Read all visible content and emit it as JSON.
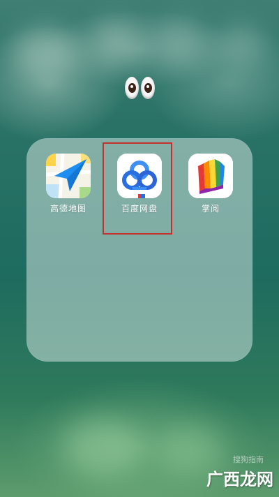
{
  "folder": {
    "apps": [
      {
        "label": "高德地图",
        "icon": "amap-icon",
        "highlighted": false
      },
      {
        "label": "百度网盘",
        "icon": "baidu-netdisk-icon",
        "highlighted": true
      },
      {
        "label": "掌阅",
        "icon": "ireader-icon",
        "highlighted": false
      }
    ]
  },
  "decor": {
    "eyes": "eyes-emoji",
    "highlight_color": "#c4302b"
  },
  "watermark": {
    "small_text": "搜狗指南",
    "brand_text": "广西龙网"
  }
}
